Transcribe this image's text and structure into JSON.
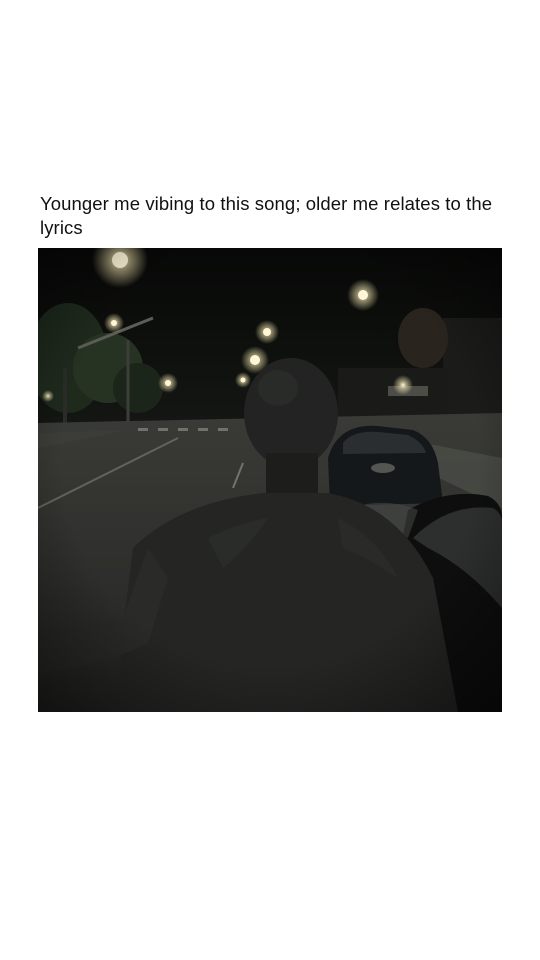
{
  "post": {
    "caption": "Younger me vibing to this song; older me relates to the lyrics"
  },
  "colors": {
    "background": "#ffffff",
    "caption_text": "#111111",
    "night_sky": "#0e100f",
    "street_light": "#fff6d8"
  }
}
